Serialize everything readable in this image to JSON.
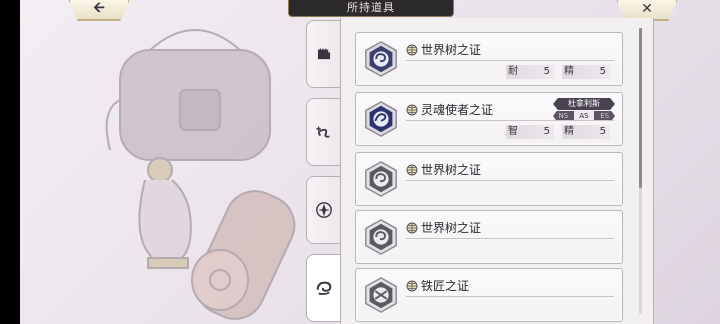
{
  "header": {
    "back_icon": "arrow-left-icon",
    "title": "所持道具",
    "close_icon": "close-x-icon"
  },
  "side_tabs": [
    {
      "icon": "fist-icon",
      "active": false
    },
    {
      "icon": "swirl-plus-icon",
      "active": false
    },
    {
      "icon": "star-emblem-icon",
      "active": false
    },
    {
      "icon": "wave-swirl-icon",
      "active": true
    }
  ],
  "items": [
    {
      "name": "世界树之证",
      "gem_color": "#3b3f6e",
      "stats": [
        {
          "label": "耐",
          "value": "5"
        },
        {
          "label": "精",
          "value": "5"
        }
      ]
    },
    {
      "name": "灵魂使者之证",
      "gem_color": "#2c3470",
      "character": "杜拿利斯",
      "ranks": [
        "NS",
        "AS",
        "ES"
      ],
      "active_rank": "AS",
      "stats": [
        {
          "label": "智",
          "value": "5"
        },
        {
          "label": "精",
          "value": "5"
        }
      ]
    },
    {
      "name": "世界树之证",
      "gem_color": "#5a5a60",
      "stats": []
    },
    {
      "name": "世界树之证",
      "gem_color": "#5a5a60",
      "stats": []
    },
    {
      "name": "铁匠之证",
      "gem_color": "#5a5a60",
      "stats": []
    }
  ]
}
